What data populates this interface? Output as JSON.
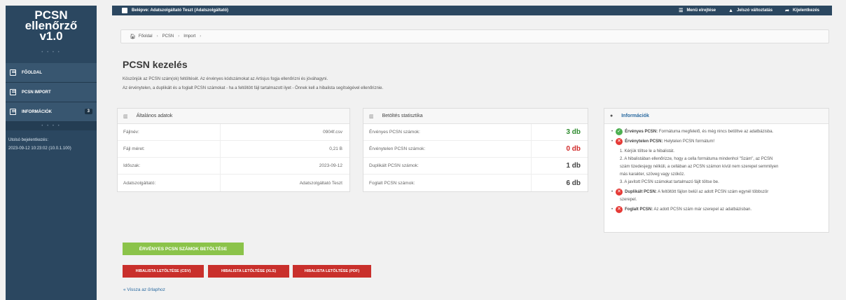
{
  "app": {
    "logo_line1": "PCSN",
    "logo_line2": "ellenőrző",
    "logo_line3": "v1.0"
  },
  "sidebar": {
    "items": [
      {
        "label": "FŐOLDAL",
        "icon": "edit-icon"
      },
      {
        "label": "PCSN IMPORT",
        "icon": "edit-icon"
      },
      {
        "label": "INFORMÁCIÓK",
        "icon": "edit-icon",
        "badge": "3"
      }
    ],
    "last_login_label": "Utolsó bejelentkezés:",
    "last_login_value": "2023-09-12 10:23:02 (10.0.1.100)"
  },
  "topbar": {
    "user_text": "Belépve: Adatszolgáltató Teszt (Adatszolgáltató)",
    "menu_toggle": "Menü elrejtése",
    "password_change": "Jelszó változtatás",
    "logout": "Kijelentkezés"
  },
  "breadcrumb": {
    "home": "Főoldal",
    "items": [
      "PCSN",
      "Import"
    ]
  },
  "page": {
    "title": "PCSN kezelés",
    "desc1": "Köszönjük az PCSN szám(ok) feltöltését. Az érvényes kódszámokat az Artisjus fogja ellenőrizni és jóváhagyni.",
    "desc2": "Az érvénytelen, a duplikált és a foglalt PCSN számokat - ha a feltöltött fájl tartalmazott ilyet - Önnek kell a hibalista segítségével ellenőriznie."
  },
  "general": {
    "title": "Általános adatok",
    "rows": [
      {
        "k": "Fájlnév:",
        "v": "0904f.csv"
      },
      {
        "k": "Fájl méret:",
        "v": "0,21 B"
      },
      {
        "k": "Időszak:",
        "v": "2023-09-12"
      },
      {
        "k": "Adatszolgáltató:",
        "v": "Adatszolgáltató Teszt"
      }
    ]
  },
  "stats": {
    "title": "Betöltés statisztika",
    "rows": [
      {
        "k": "Érvényes PCSN számok:",
        "v": "3 db",
        "color": "#2e8b2e"
      },
      {
        "k": "Érvénytelen PCSN számok:",
        "v": "0 db",
        "color": "#d12a2a"
      },
      {
        "k": "Duplikált PCSN számok:",
        "v": "1 db",
        "color": "#444444"
      },
      {
        "k": "Foglalt PCSN számok:",
        "v": "6 db",
        "color": "#444444"
      }
    ]
  },
  "info": {
    "title": "Információk",
    "valid_label": "Érvényes PCSN:",
    "valid_text": "Formátuma megfelelő, és még nincs betöltve az adatbázisba.",
    "invalid_label": "Érvénytelen PCSN:",
    "invalid_text": "Helytelen PCSN formátum!",
    "invalid_steps": [
      "1. Kérjük töltse le a hibalistát.",
      "2. A hibalistában ellenőrizze, hogy a cella formátuma mindenhol \"Szám\", az PCSN",
      "szám tizedesjegy nélküli, a cellában az PCSN számon kívül nem szerepel semmilyen",
      "más karakter, szöveg vagy szóköz.",
      "3. A javított PCSN számokat tartalmazó fájlt töltse be."
    ],
    "dup_label": "Duplikált PCSN:",
    "dup_text": "A feltöltött fájlon belül az adott PCSN szám egynél többször",
    "dup_text2": "szerepel.",
    "taken_label": "Foglalt PCSN:",
    "taken_text": "Az adott PCSN szám már szerepel az adatbázisban."
  },
  "actions": {
    "load_valid": "ÉRVÉNYES PCSN SZÁMOK BETÖLTÉSE",
    "dl_csv": "HIBALISTA LETÖLTÉSE (CSV)",
    "dl_xls": "HIBALISTA LETÖLTÉSE (XLS)",
    "dl_pdf": "HIBALISTA LETÖLTÉSE (PDF)",
    "back": "« Vissza az űrlaphoz"
  }
}
